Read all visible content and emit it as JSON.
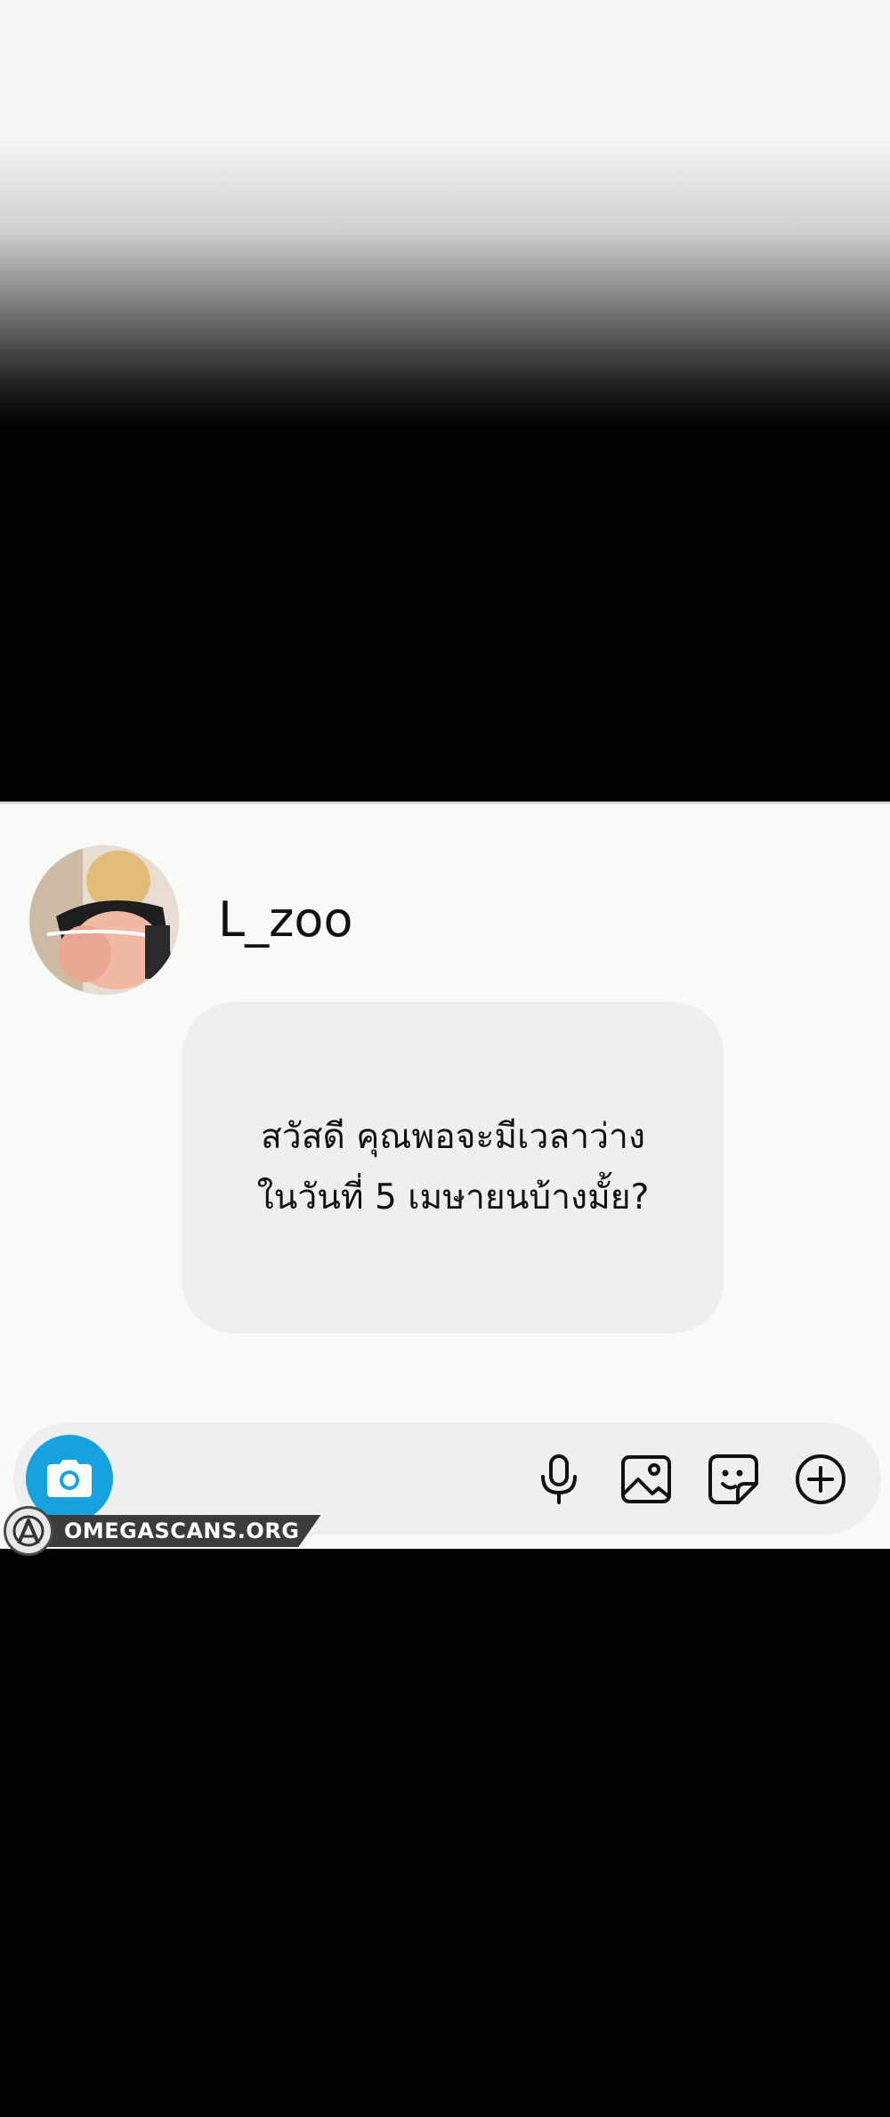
{
  "chat": {
    "contact": {
      "username": "L_zoo",
      "avatar_icon": "profile-photo"
    },
    "message": {
      "text": "สวัสดี คุณพอจะมีเวลาว่าง\nในวันที่ 5 เมษายนบ้างมั้ย?"
    }
  },
  "composer": {
    "camera_icon": "camera-icon",
    "mic_icon": "microphone-icon",
    "gallery_icon": "image-icon",
    "sticker_icon": "sticker-icon",
    "add_icon": "plus-circle-icon",
    "accent_color": "#16a3dd"
  },
  "watermark": {
    "text": "OMEGASCANS.ORG"
  }
}
